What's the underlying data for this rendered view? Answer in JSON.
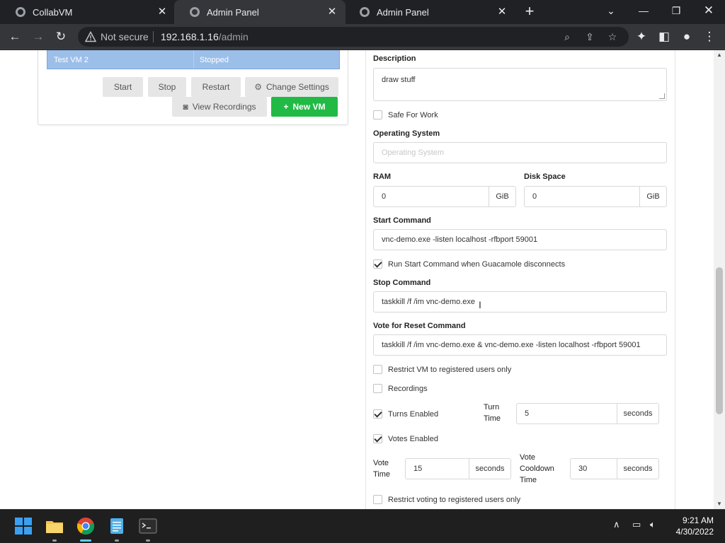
{
  "browser": {
    "tabs": [
      {
        "title": "CollabVM",
        "active": false
      },
      {
        "title": "Admin Panel",
        "active": true
      },
      {
        "title": "Admin Panel",
        "active": false
      }
    ],
    "security_label": "Not secure",
    "url_host": "192.168.1.16",
    "url_path": "/admin"
  },
  "vm_list": {
    "selected_row": {
      "name": "Test VM 2",
      "status": "Stopped"
    },
    "buttons": {
      "start": "Start",
      "stop": "Stop",
      "restart": "Restart",
      "change_settings": "Change Settings",
      "view_recordings": "View Recordings",
      "new_vm": "New VM"
    }
  },
  "form": {
    "description_label": "Description",
    "description_value": "draw stuff",
    "safe_for_work": {
      "label": "Safe For Work",
      "checked": false
    },
    "os_label": "Operating System",
    "os_placeholder": "Operating System",
    "ram_label": "RAM",
    "ram_value": "0",
    "ram_unit": "GiB",
    "disk_label": "Disk Space",
    "disk_value": "0",
    "disk_unit": "GiB",
    "start_command_label": "Start Command",
    "start_command_value": "vnc-demo.exe -listen localhost -rfbport 59001",
    "run_start_on_disconnect": {
      "label": "Run Start Command when Guacamole disconnects",
      "checked": true
    },
    "stop_command_label": "Stop Command",
    "stop_command_value": "taskkill /f /im vnc-demo.exe",
    "reset_command_label": "Vote for Reset Command",
    "reset_command_value": "taskkill /f /im vnc-demo.exe & vnc-demo.exe -listen localhost -rfbport 59001",
    "restrict_vm": {
      "label": "Restrict VM to registered users only",
      "checked": false
    },
    "recordings": {
      "label": "Recordings",
      "checked": false
    },
    "turns_enabled": {
      "label": "Turns Enabled",
      "checked": true
    },
    "turn_time_label_1": "Turn",
    "turn_time_label_2": "Time",
    "turn_time_value": "5",
    "turn_time_unit": "seconds",
    "votes_enabled": {
      "label": "Votes Enabled",
      "checked": true
    },
    "vote_time_label_1": "Vote",
    "vote_time_label_2": "Time",
    "vote_time_value": "15",
    "vote_time_unit": "seconds",
    "vote_cooldown_label_1": "Vote",
    "vote_cooldown_label_2": "Cooldown",
    "vote_cooldown_label_3": "Time",
    "vote_cooldown_value": "30",
    "vote_cooldown_unit": "seconds",
    "restrict_voting": {
      "label": "Restrict voting to registered users only",
      "checked": false
    }
  },
  "taskbar": {
    "apps": [
      "start-menu",
      "file-explorer",
      "chrome",
      "notepad",
      "terminal"
    ],
    "time": "9:21 AM",
    "date": "4/30/2022"
  }
}
